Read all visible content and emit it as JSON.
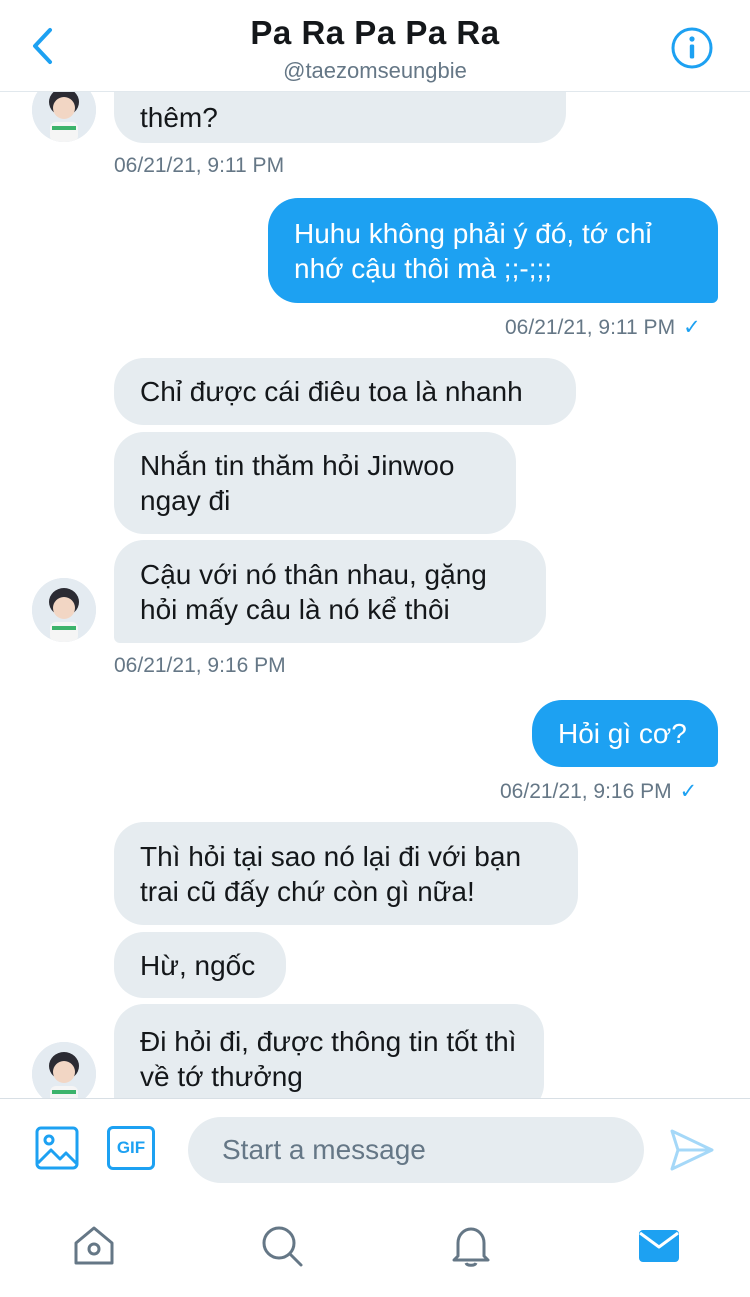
{
  "header": {
    "title": "Pa Ra Pa Pa Ra",
    "handle": "@taezomseungbie"
  },
  "icons": {
    "back": "chevron-left-icon",
    "info": "info-icon",
    "media": "image-icon",
    "gif": "gif-icon",
    "send": "send-icon",
    "home": "home-icon",
    "search": "search-icon",
    "notifications": "bell-icon",
    "messages": "mail-icon"
  },
  "colors": {
    "accent": "#1da1f2",
    "incoming_bubble": "#e6ecf0",
    "timestamp": "#657786"
  },
  "messages": [
    {
      "from": "them",
      "text": "thêm?"
    },
    {
      "from": "them_ts",
      "text": "06/21/21, 9:11 PM"
    },
    {
      "from": "me",
      "text": "Huhu không phải ý đó, tớ chỉ nhớ cậu thôi mà ;;-;;;"
    },
    {
      "from": "me_ts",
      "text": "06/21/21, 9:11 PM",
      "check": "✓"
    },
    {
      "from": "them",
      "text": "Chỉ được cái điêu toa là nhanh"
    },
    {
      "from": "them",
      "text": "Nhắn tin thăm hỏi Jinwoo ngay đi"
    },
    {
      "from": "them",
      "text": "Cậu với nó thân nhau, gặng hỏi mấy câu là nó kể thôi"
    },
    {
      "from": "them_ts",
      "text": "06/21/21, 9:16 PM"
    },
    {
      "from": "me",
      "text": "Hỏi gì cơ?"
    },
    {
      "from": "me_ts",
      "text": "06/21/21, 9:16 PM",
      "check": "✓"
    },
    {
      "from": "them",
      "text": "Thì hỏi tại sao nó lại đi với bạn trai cũ đấy chứ còn gì nữa!"
    },
    {
      "from": "them",
      "text": "Hừ, ngốc"
    },
    {
      "from": "them",
      "text": "Đi hỏi đi, được thông tin tốt thì về tớ thưởng"
    }
  ],
  "composer": {
    "gif_label": "GIF",
    "placeholder": "Start a message"
  }
}
